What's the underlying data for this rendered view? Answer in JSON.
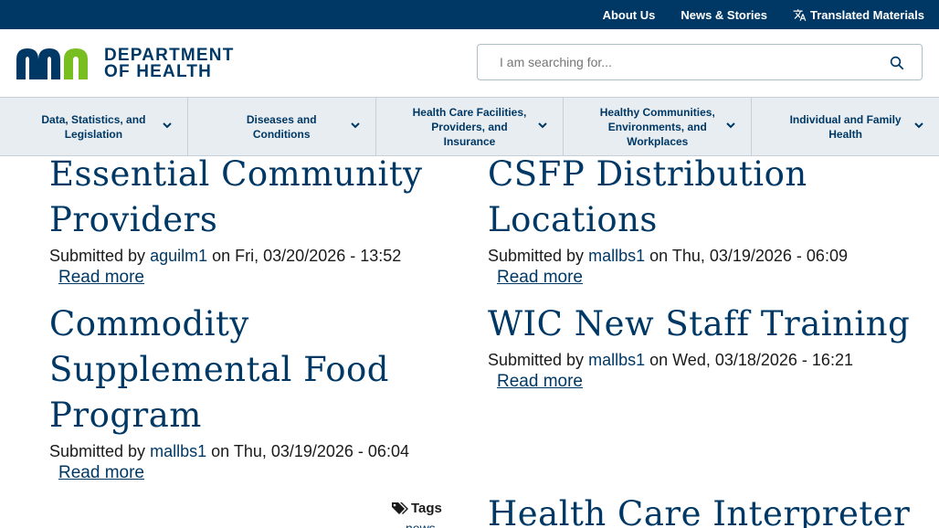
{
  "topbar": {
    "links": [
      "About Us",
      "News & Stories",
      "Translated Materials"
    ]
  },
  "logo": {
    "line1": "DEPARTMENT",
    "line2": "OF HEALTH",
    "mark_colors": [
      "#003865",
      "#78be21"
    ]
  },
  "search": {
    "placeholder": "I am searching for..."
  },
  "nav": [
    "Data, Statistics, and Legislation",
    "Diseases and Conditions",
    "Health Care Facilities, Providers, and Insurance",
    "Healthy Communities, Environments, and Workplaces",
    "Individual and Family Health"
  ],
  "cards": [
    {
      "title": "Essential Community Providers",
      "submitted": "Submitted by",
      "user": "aguilm1",
      "on": "on Fri, 03/20/2026 - 13:52",
      "more": "Read more"
    },
    {
      "title": "CSFP Distribution Locations",
      "submitted": "Submitted by",
      "user": "mallbs1",
      "on": "on Thu, 03/19/2026 - 06:09",
      "more": "Read more"
    },
    {
      "title": "Commodity Supplemental Food Program",
      "submitted": "Submitted by",
      "user": "mallbs1",
      "on": "on Thu, 03/19/2026 - 06:04",
      "more": "Read more"
    },
    {
      "title": "WIC New Staff Training",
      "submitted": "Submitted by",
      "user": "mallbs1",
      "on": "on Wed, 03/18/2026 - 16:21",
      "more": "Read more"
    },
    {
      "title": "Health Care Interpreter"
    }
  ],
  "tags": {
    "label": "Tags",
    "first": "news"
  },
  "colors": {
    "brand": "#003865",
    "accent": "#78be21",
    "nav_bg": "#e8edf1"
  }
}
